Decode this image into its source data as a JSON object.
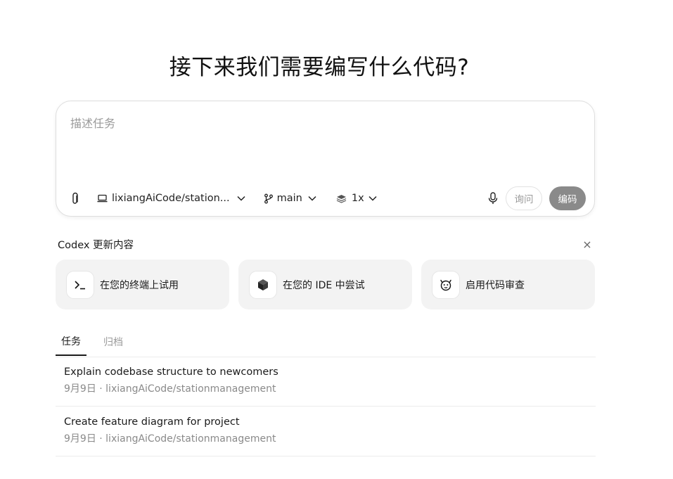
{
  "heading": "接下来我们需要编写什么代码?",
  "composer": {
    "placeholder": "描述任务",
    "repo": "lixiangAiCode/station...",
    "branch": "main",
    "count": "1x",
    "ask_label": "询问",
    "code_label": "编码"
  },
  "updates": {
    "title": "Codex 更新内容",
    "close": "×",
    "cards": [
      {
        "label": "在您的终端上试用",
        "icon": "terminal-icon"
      },
      {
        "label": "在您的 IDE 中尝试",
        "icon": "cube-icon"
      },
      {
        "label": "启用代码审查",
        "icon": "review-face-icon"
      }
    ]
  },
  "tabs": [
    {
      "label": "任务",
      "active": true
    },
    {
      "label": "归档",
      "active": false
    }
  ],
  "tasks": [
    {
      "title": "Explain codebase structure to newcomers",
      "meta": "9月9日 · lixiangAiCode/stationmanagement"
    },
    {
      "title": "Create feature diagram for project",
      "meta": "9月9日 · lixiangAiCode/stationmanagement"
    }
  ],
  "colors": {
    "code_button_bg": "#8a8a8a",
    "card_bg": "#f3f3f3"
  }
}
